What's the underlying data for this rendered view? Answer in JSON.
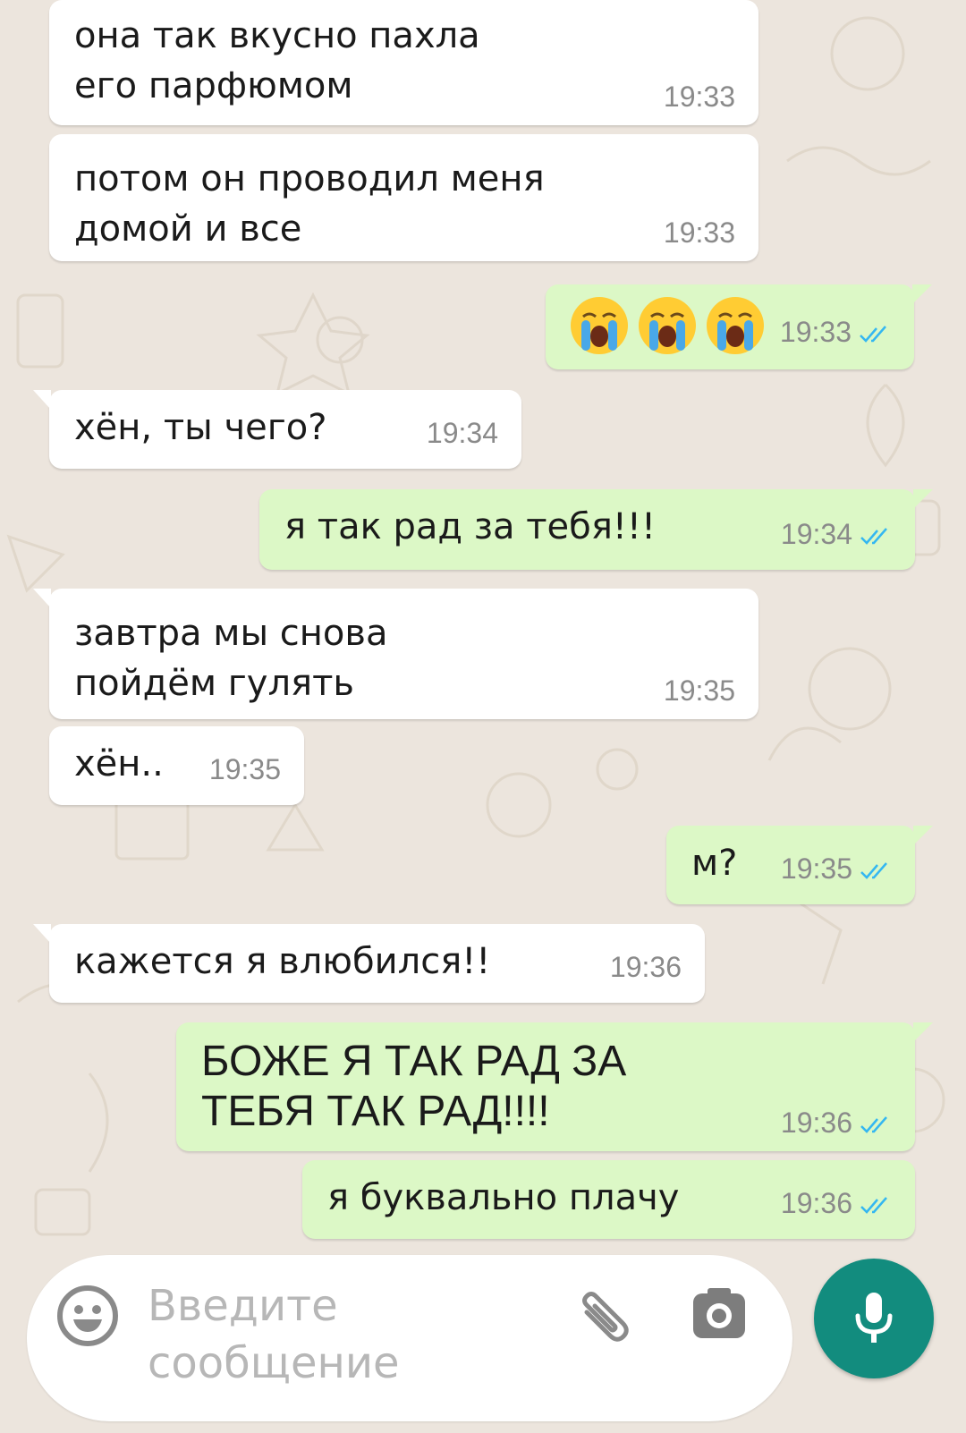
{
  "colors": {
    "background": "#ECE5DD",
    "incoming_bubble": "#ffffff",
    "outgoing_bubble": "#DCF8C6",
    "timestamp": "#8a8a8a",
    "read_ticks": "#34B7F1",
    "mic_button": "#128C7E"
  },
  "messages": [
    {
      "direction": "in",
      "text": "она так вкусно пахла его парфюмом",
      "time": "19:33"
    },
    {
      "direction": "in",
      "text": "потом он проводил меня домой и все",
      "time": "19:33"
    },
    {
      "direction": "out",
      "text": "😭😭😭",
      "time": "19:33",
      "status": "read"
    },
    {
      "direction": "in",
      "text": "хён, ты чего?",
      "time": "19:34"
    },
    {
      "direction": "out",
      "text": "я так рад за тебя!!!",
      "time": "19:34",
      "status": "read"
    },
    {
      "direction": "in",
      "text": "завтра мы снова пойдём гулять",
      "time": "19:35"
    },
    {
      "direction": "in",
      "text": "хён..",
      "time": "19:35"
    },
    {
      "direction": "out",
      "text": "м?",
      "time": "19:35",
      "status": "read"
    },
    {
      "direction": "in",
      "text": "кажется я влюбился!!",
      "time": "19:36"
    },
    {
      "direction": "out",
      "text": "БОЖЕ Я ТАК РАД ЗА ТЕБЯ ТАК РАД!!!!",
      "time": "19:36",
      "status": "read"
    },
    {
      "direction": "out",
      "text": "я буквально плачу",
      "time": "19:36",
      "status": "read"
    }
  ],
  "input": {
    "placeholder": "Введите сообщение",
    "emoji_icon": "smiley-icon",
    "attach_icon": "paperclip-icon",
    "camera_icon": "camera-icon",
    "mic_icon": "microphone-icon"
  }
}
